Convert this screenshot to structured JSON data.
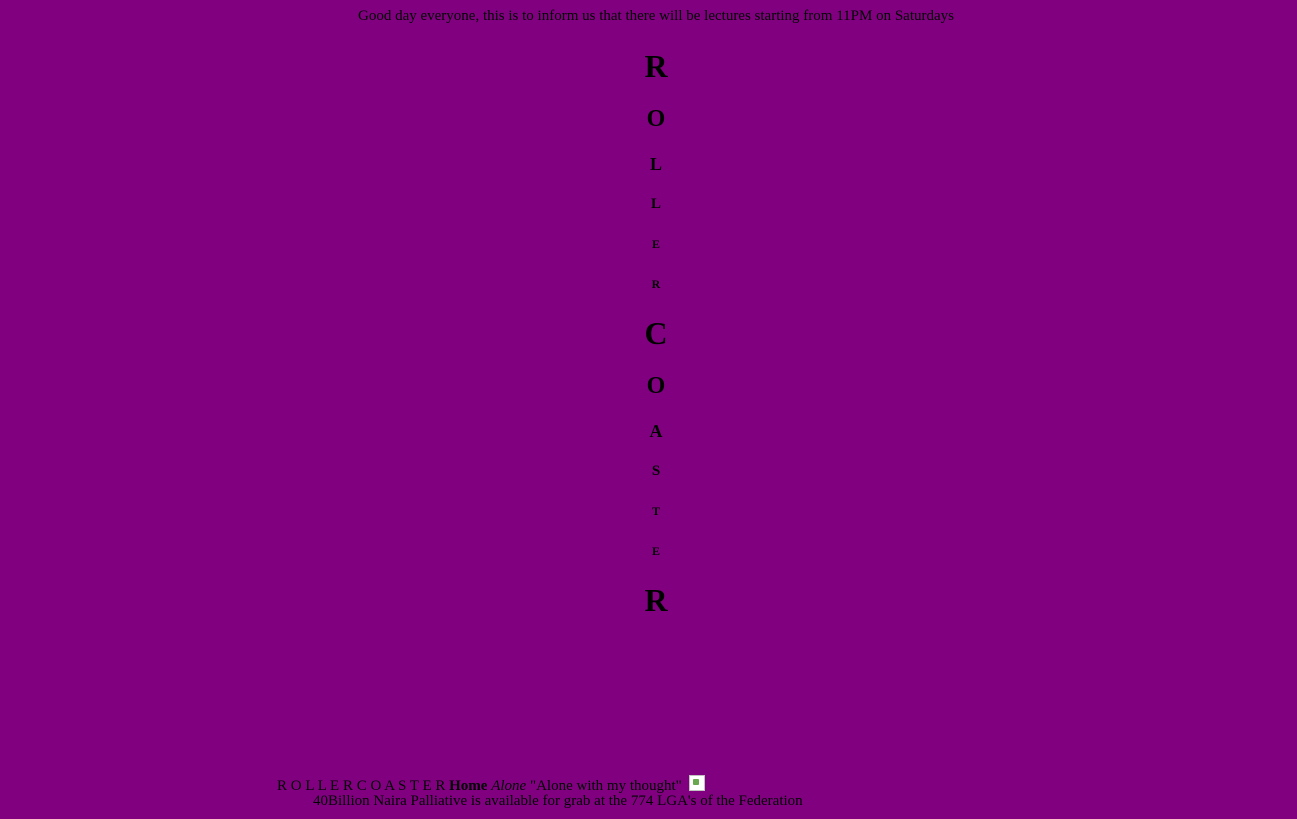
{
  "announcement": "Good day everyone, this is to inform us that there will be lectures starting from 11PM on Saturdays",
  "vertical_letters": [
    "R",
    "O",
    "L",
    "L",
    "E",
    "R",
    "C",
    "O",
    "A",
    "S",
    "T",
    "E",
    "R"
  ],
  "footer": {
    "spaced_title": "R O L L E R C O A S T E R",
    "bold_text": "Home",
    "italic_text": "Alone",
    "quote": "\"Alone with my thought\""
  },
  "marquee_text": "40Billion Naira Palliative is available for grab at the 774 LGA's of the Federation",
  "colors": {
    "background": "#800080",
    "text": "#000000"
  }
}
